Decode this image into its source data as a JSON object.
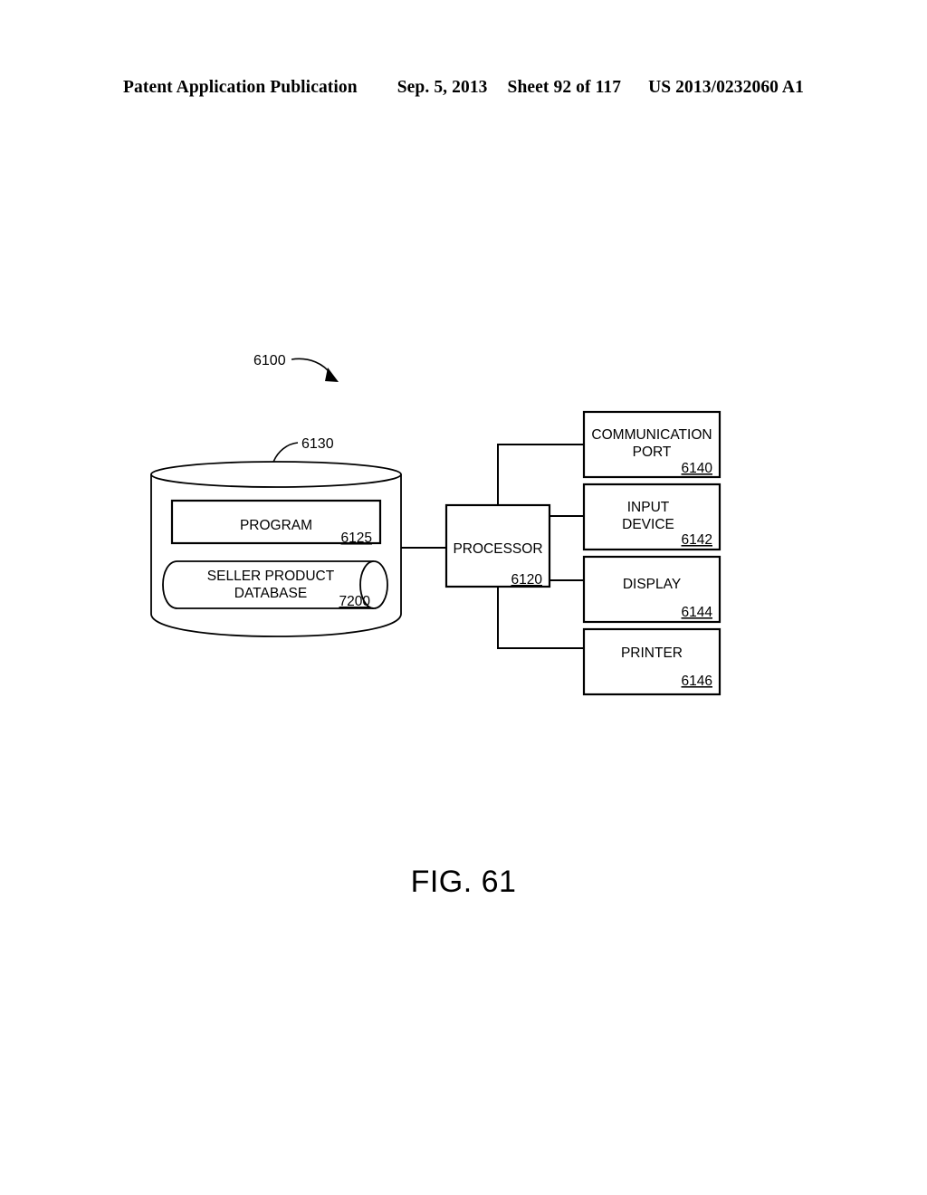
{
  "header": {
    "publication": "Patent Application Publication",
    "date": "Sep. 5, 2013",
    "sheet": "Sheet 92 of 117",
    "patent_number": "US 2013/0232060 A1"
  },
  "figure": {
    "caption": "FIG. 61",
    "system_ref": "6100",
    "storage": {
      "ref": "6130",
      "program": {
        "label": "PROGRAM",
        "ref": "6125"
      },
      "database": {
        "label_line1": "SELLER PRODUCT",
        "label_line2": "DATABASE",
        "ref": "7200"
      }
    },
    "processor": {
      "label": "PROCESSOR",
      "ref": "6120"
    },
    "peripherals": [
      {
        "label_line1": "COMMUNICATION",
        "label_line2": "PORT",
        "ref": "6140"
      },
      {
        "label_line1": "INPUT",
        "label_line2": "DEVICE",
        "ref": "6142"
      },
      {
        "label_line1": "DISPLAY",
        "label_line2": "",
        "ref": "6144"
      },
      {
        "label_line1": "PRINTER",
        "label_line2": "",
        "ref": "6146"
      }
    ]
  }
}
